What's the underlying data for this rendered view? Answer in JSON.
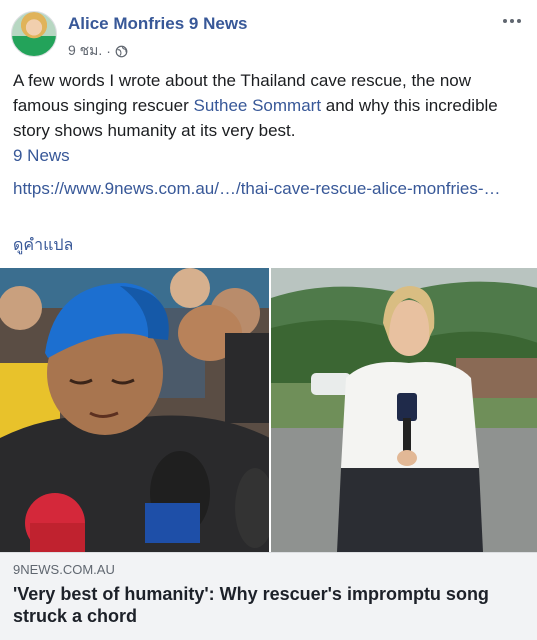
{
  "post": {
    "author": "Alice Monfries 9 News",
    "timestamp": "9 ชม.",
    "separator": "·",
    "privacy_icon": "globe-icon",
    "more_icon": "more-options-icon"
  },
  "body": {
    "text_before_link": "A few words I wrote about the Thailand cave rescue, the now famous singing rescuer ",
    "mention": "Suthee Sommart",
    "text_after_link": " and why this incredible story shows humanity at its very best.",
    "source": "9 News",
    "url": "https://www.9news.com.au/…/thai-cave-rescue-alice-monfries-…",
    "translate": "ดูคำแปล"
  },
  "link_preview": {
    "domain": "9NEWS.COM.AU",
    "headline": "'Very best of humanity': Why rescuer's impromptu song struck a chord",
    "left_image": "rescuer in blue cap with microphones",
    "right_image": "reporter holding 9 News microphone"
  },
  "colors": {
    "link": "#385898",
    "text": "#1c1e21",
    "meta": "#616770",
    "caption_bg": "#f2f3f5"
  }
}
